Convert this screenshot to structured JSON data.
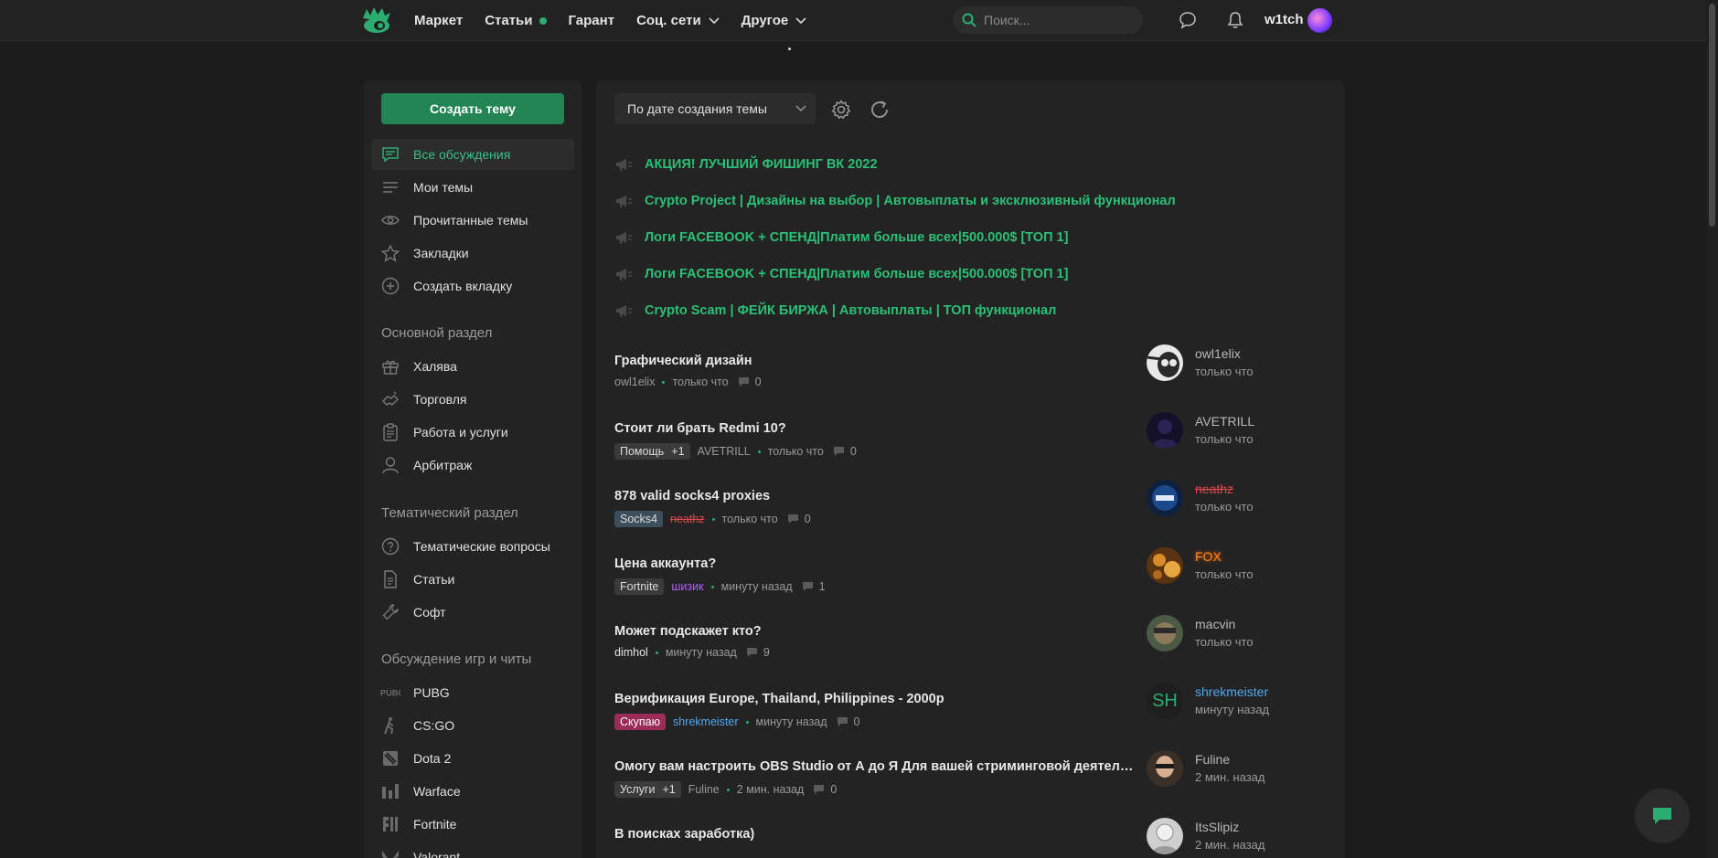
{
  "header": {
    "nav": [
      {
        "label": "Маркет"
      },
      {
        "label": "Статьи"
      },
      {
        "label": "Гарант"
      },
      {
        "label": "Соц. сети"
      },
      {
        "label": "Другое"
      }
    ],
    "search_placeholder": "Поиск...",
    "username": "w1tch"
  },
  "sidebar": {
    "create_label": "Создать тему",
    "items": [
      {
        "label": "Все обсуждения",
        "icon": "chat-icon"
      },
      {
        "label": "Мои темы",
        "icon": "lines-icon"
      },
      {
        "label": "Прочитанные темы",
        "icon": "eye-icon"
      },
      {
        "label": "Закладки",
        "icon": "star-icon"
      },
      {
        "label": "Создать вкладку",
        "icon": "plus-circle-icon"
      }
    ],
    "sections": [
      {
        "title": "Основной раздел",
        "items": [
          {
            "label": "Халява",
            "icon": "gift-icon"
          },
          {
            "label": "Торговля",
            "icon": "handshake-icon"
          },
          {
            "label": "Работа и услуги",
            "icon": "clipboard-icon"
          },
          {
            "label": "Арбитраж",
            "icon": "user-icon"
          }
        ]
      },
      {
        "title": "Тематический раздел",
        "items": [
          {
            "label": "Тематические вопросы",
            "icon": "question-icon"
          },
          {
            "label": "Статьи",
            "icon": "document-icon"
          },
          {
            "label": "Софт",
            "icon": "wrench-icon"
          }
        ]
      },
      {
        "title": "Обсуждение игр и читы",
        "items": [
          {
            "label": "PUBG",
            "icon": "pubg-icon"
          },
          {
            "label": "CS:GO",
            "icon": "csgo-icon"
          },
          {
            "label": "Dota 2",
            "icon": "dota-icon"
          },
          {
            "label": "Warface",
            "icon": "warface-icon"
          },
          {
            "label": "Fortnite",
            "icon": "fortnite-icon"
          },
          {
            "label": "Valorant",
            "icon": "valorant-icon"
          }
        ]
      }
    ]
  },
  "toolbar": {
    "sort_label": "По дате создания темы"
  },
  "sticky": [
    "АКЦИЯ! ЛУЧШИЙ ФИШИНГ ВК 2022",
    "Crypto Project | Дизайны на выбор | Автовыплаты и эксклюзивный функционал",
    "Логи FACEBOOK + СПЕНД|Платим больше всех|500.000$ [ТОП 1]",
    "Логи FACEBOOK + СПЕНД|Платим больше всех|500.000$ [ТОП 1]",
    "Crypto Scam | ФЕЙК БИРЖА | Автовыплаты | ТОП функционал"
  ],
  "threads": [
    {
      "title": "Графический дизайн",
      "tag": "",
      "plus": "",
      "author": "owl1elix",
      "time": "только что",
      "replies": "0",
      "last_user": "owl1elix",
      "last_time": "только что"
    },
    {
      "title": "Стоит ли брать Redmi 10?",
      "tag": "Помощь",
      "plus": "+1",
      "author": "AVETRILL",
      "time": "только что",
      "replies": "0",
      "last_user": "AVETRILL",
      "last_time": "только что"
    },
    {
      "title": "878 valid socks4 proxies",
      "tag": "Socks4",
      "plus": "",
      "author": "neathz",
      "time": "только что",
      "replies": "0",
      "last_user": "neathz",
      "last_time": "только что"
    },
    {
      "title": "Цена аккаунта?",
      "tag": "Fortnite",
      "plus": "",
      "author": "шизик",
      "time": "минуту назад",
      "replies": "1",
      "last_user": "FOX",
      "last_time": "только что"
    },
    {
      "title": "Может подскажет кто?",
      "tag": "",
      "plus": "",
      "author": "dimhol",
      "time": "минуту назад",
      "replies": "9",
      "last_user": "macvin",
      "last_time": "только что"
    },
    {
      "title": "Верификация Europe, Thailand, Philippines - 2000р",
      "tag": "Скупаю",
      "plus": "",
      "author": "shrekmeister",
      "time": "минуту назад",
      "replies": "0",
      "last_user": "shrekmeister",
      "last_time": "минуту назад",
      "avatar_text": "SH"
    },
    {
      "title": "Омогу вам настроить OBS Studio от А до Я Для вашей стриминговой деятельности",
      "tag": "Услуги",
      "plus": "+1",
      "author": "Fuline",
      "time": "2 мин. назад",
      "replies": "0",
      "last_user": "Fuline",
      "last_time": "2 мин. назад"
    },
    {
      "title": "В поисках заработка)",
      "tag": "",
      "plus": "",
      "author": "",
      "time": "",
      "replies": "",
      "last_user": "ItsSlipiz",
      "last_time": "2 мин. назад"
    }
  ],
  "colors": {
    "accent": "#2bad72",
    "button": "#238553",
    "sticky_text": "#2bc075",
    "background": "#1c1c1c",
    "panel": "#232323"
  }
}
